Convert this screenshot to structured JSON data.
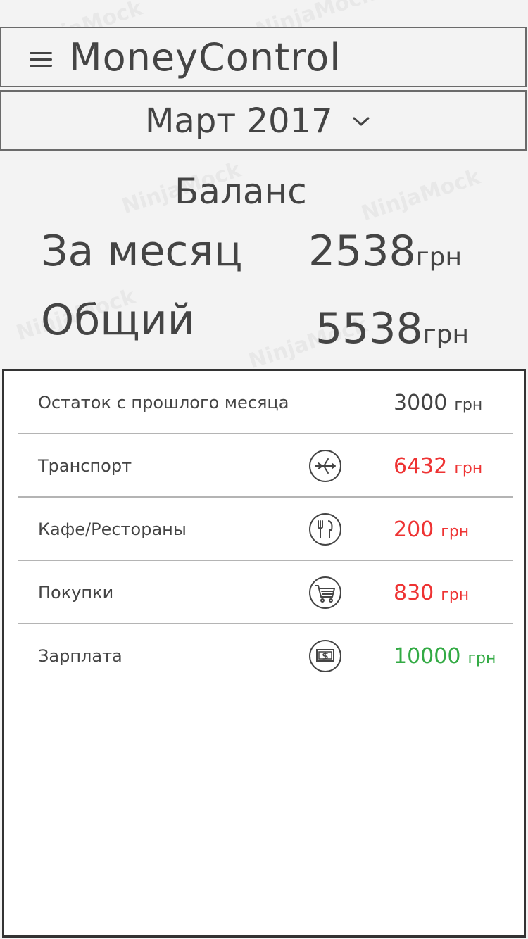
{
  "header": {
    "app_title": "MoneyControl",
    "menu_icon": "hamburger-menu-icon"
  },
  "period": {
    "label": "Март 2017",
    "icon": "chevron-down-icon"
  },
  "balance": {
    "title": "Баланс",
    "month_label": "За месяц",
    "month_value": "2538",
    "month_unit": "грн",
    "total_label": "Общий",
    "total_value": "5538",
    "total_unit": "грн"
  },
  "transactions": [
    {
      "label": "Остаток с прошлого месяца",
      "icon": "",
      "value": "3000",
      "unit": "грн",
      "status": "neutral",
      "color": "#444444"
    },
    {
      "label": "Транспорт",
      "icon": "airplane-icon",
      "value": "6432",
      "unit": "грн",
      "status": "expense",
      "color": "#ee3333"
    },
    {
      "label": "Кафе/Рестораны",
      "icon": "fork-knife-icon",
      "value": "200",
      "unit": "грн",
      "status": "expense",
      "color": "#ee3333"
    },
    {
      "label": "Покупки",
      "icon": "shopping-cart-icon",
      "value": "830",
      "unit": "грн",
      "status": "expense",
      "color": "#ee3333"
    },
    {
      "label": "Зарплата",
      "icon": "money-bill-icon",
      "value": "10000",
      "unit": "грн",
      "status": "income",
      "color": "#33aa44"
    }
  ],
  "watermark": {
    "text": "NinjaMock"
  }
}
